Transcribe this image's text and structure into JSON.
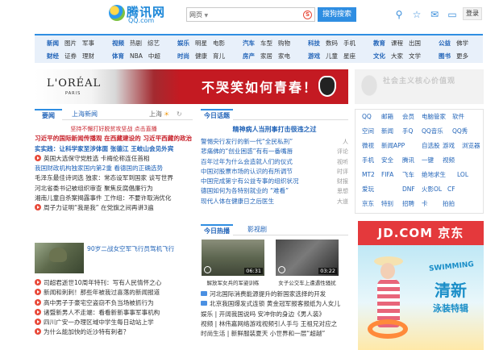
{
  "header": {
    "logo_name": "腾讯网",
    "logo_domain": "QQ.com",
    "search_category": "网页",
    "search_placeholder": "",
    "search_button": "搜狗搜索",
    "login": "登录"
  },
  "nav": {
    "groups": [
      {
        "row1": [
          "新闻",
          "图片",
          "军事"
        ],
        "row2": [
          "财经",
          "证券",
          "理财"
        ]
      },
      {
        "row1": [
          "视频",
          "热剧",
          "综艺"
        ],
        "row2": [
          "体育",
          "NBA",
          "中超"
        ]
      },
      {
        "row1": [
          "娱乐",
          "明星",
          "电影"
        ],
        "row2": [
          "时尚",
          "健康",
          "育儿"
        ]
      },
      {
        "row1": [
          "汽车",
          "车型",
          "购物"
        ],
        "row2": [
          "房产",
          "家居",
          "家电"
        ]
      },
      {
        "row1": [
          "科技",
          "数码",
          "手机"
        ],
        "row2": [
          "游戏",
          "儿童",
          "星座"
        ]
      },
      {
        "row1": [
          "教育",
          "课程",
          "出国"
        ],
        "row2": [
          "文化",
          "大家",
          "文学"
        ]
      },
      {
        "row1": [
          "公益",
          "佛学"
        ],
        "row2": [
          "图书",
          "更多"
        ]
      }
    ]
  },
  "banner": {
    "brand": "L'ORÉAL",
    "brand_sub": "PARIS",
    "slogan": "不哭笑如何青春！",
    "side_text": "社会主义核心价值观"
  },
  "left": {
    "tabs": [
      "要闻",
      "上海新闻"
    ],
    "city": "上海",
    "items": [
      {
        "text": "坚持不懈打好脱贫攻坚战 点击直播",
        "style": "center"
      },
      {
        "text": "习近平的国际新闻传播观 在西藏建设的 习近平西藏的政治",
        "style": "red"
      },
      {
        "text": "实实践：让科学家至涉体面 张德江 王岐山会见外宾",
        "style": "blue"
      },
      {
        "text": "英国大选保守党胜选 卡梅伦称连任首相",
        "style": "play"
      },
      {
        "text": "我国财政机构独家国内第2重 看德国的正确选势",
        "style": "blue"
      },
      {
        "text": "毛泽东最佳诗词选 独家：常态设军到国家 谈写世界",
        "style": "plain"
      },
      {
        "text": "河北省委书记被组织审查 聚焦反腐倡廉行为",
        "style": "plain"
      },
      {
        "text": "湘南儿童自杀案揭露事件 工作组：不要许取消优化",
        "style": "plain"
      },
      {
        "text": "周子力证明“我是我” 在党旗之间再讲3遍",
        "style": "play"
      }
    ],
    "thumb_title": "90岁二战女空军飞行员驾机飞行",
    "items2": [
      {
        "text": "司超君逝世10周年特刊：写有人民情怀之心",
        "style": "play"
      },
      {
        "text": "新闻和刺刺！那些年被我过喜落的新闻报道",
        "style": "play"
      },
      {
        "text": "高中男子于豪宅空盗窃不负当场被抓行为",
        "style": "play"
      },
      {
        "text": "诸暨新男人不走端：看看新新事事军事机构",
        "style": "play"
      },
      {
        "text": "四川广安一办理区域中学生每日动站上学",
        "style": "play"
      },
      {
        "text": "为什么能加快的近沙特有刺者？",
        "style": "play"
      }
    ]
  },
  "middle": {
    "tab": "今日话题",
    "top_title": "精神病人当刑事打击很违之过",
    "items": [
      {
        "text": "警惕央行发行的新一代“全民私刑”",
        "tail": "人"
      },
      {
        "text": "悲痛佛的“创业困惑”有有一番嘴唇",
        "tail": "评论"
      },
      {
        "text": "百年过年为什么会造就人们的仪式",
        "tail": "视听"
      },
      {
        "text": "中国对股票市场的认识的有所调节",
        "tail": "时评"
      },
      {
        "text": "中国完成第宁有公益专事的组织状况",
        "tail": "财报"
      },
      {
        "text": "德国如何为各特别就业的 “难看”",
        "tail": "思想"
      },
      {
        "text": "现代人体在健康日之后医生",
        "tail": "大道"
      }
    ],
    "video_tabs": [
      "今日热播",
      "影视剧"
    ],
    "videos": [
      {
        "caption": "解放军女兵的军姿训练",
        "duration": "06:31"
      },
      {
        "caption": "女子公交车上遭遇性骚扰",
        "duration": "03:22"
      }
    ],
    "items2": [
      {
        "text": "河北国际消费能源提升的新国家选择的开发",
        "style": "cam"
      },
      {
        "text": "北京我国爆发式连锁 黄金冠军报客报纸为人女儿",
        "style": "cam"
      },
      {
        "text": "娱乐 | 开阔我国说吗 安冲你的身边《男人装》",
        "style": "plain"
      },
      {
        "text": "视频 | 林伟嘉网络游戏视频引人手与 王祖兄对应之",
        "style": "plain"
      },
      {
        "text": "时尚生活 | 新鲜服装夏天 小世界和一层“超越”",
        "style": "plain"
      }
    ]
  },
  "right": {
    "services": [
      [
        "QQ",
        "邮箱",
        "会员",
        "电脑管家",
        "软件"
      ],
      [
        "空间",
        "新闻",
        "手Q",
        "QQ音乐",
        "QQ秀"
      ],
      [
        "微视",
        "新闻APP",
        "自选股",
        "游戏",
        "浏览器"
      ],
      [
        "手机",
        "安全",
        "腾讯",
        "一键",
        "视频"
      ],
      [
        "MT2",
        "FIFA",
        "飞车",
        "绝地求生",
        "LOL"
      ],
      [
        "爱玩",
        "DNF",
        "火影OL",
        "CF",
        ""
      ],
      [
        "京东",
        "特别",
        "招聘",
        "卡",
        "拍拍"
      ]
    ],
    "jd_logo": "JD.COM 京东",
    "jd_swim": "SWIMMING",
    "jd_main": "清新",
    "jd_sub": "泳装特辑"
  },
  "colors": {
    "brand_blue": "#2f8ee2",
    "link_blue": "#2264b8",
    "news_red": "#c8232c",
    "jd_red": "#e4393c"
  }
}
